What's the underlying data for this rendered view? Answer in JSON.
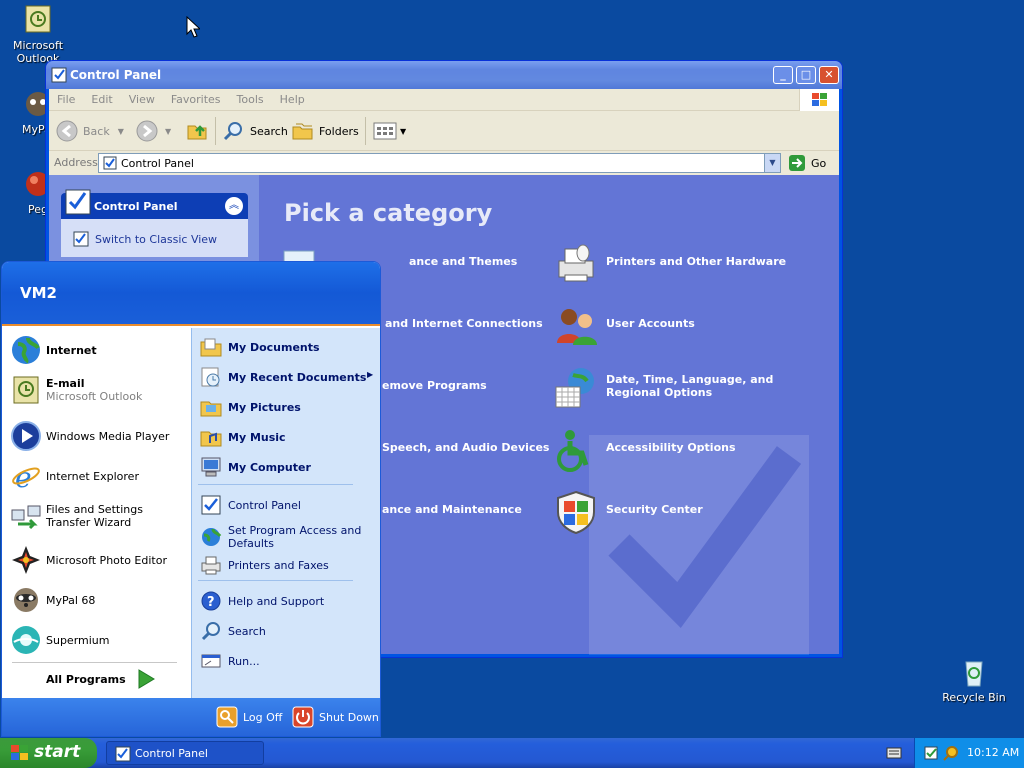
{
  "desktop": {
    "icons": [
      {
        "label": "Microsoft Outlook"
      },
      {
        "label": "MyPal"
      },
      {
        "label": "Peg"
      }
    ],
    "recycle_bin": "Recycle Bin"
  },
  "window": {
    "title": "Control Panel",
    "menu": [
      "File",
      "Edit",
      "View",
      "Favorites",
      "Tools",
      "Help"
    ],
    "toolbar": {
      "back": "Back",
      "search": "Search",
      "folders": "Folders"
    },
    "address_label": "Address",
    "address_value": "Control Panel",
    "go_label": "Go",
    "sidebar_title": "Control Panel",
    "sidebar_link": "Switch to Classic View",
    "heading": "Pick a category",
    "categories_left": [
      "ance and Themes",
      "and Internet Connections",
      "emove Programs",
      "Speech, and Audio Devices",
      "ance and Maintenance"
    ],
    "categories_right": [
      "Printers and Other Hardware",
      "User Accounts",
      "Date, Time, Language, and Regional Options",
      "Accessibility Options",
      "Security Center"
    ]
  },
  "start_menu": {
    "user": "VM2",
    "left_items": [
      {
        "label": "Internet",
        "sub": ""
      },
      {
        "label": "E-mail",
        "sub": "Microsoft Outlook"
      },
      {
        "label": "Windows Media Player",
        "sub": ""
      },
      {
        "label": "Internet Explorer",
        "sub": ""
      },
      {
        "label": "Files and Settings Transfer Wizard",
        "sub": ""
      },
      {
        "label": "Microsoft Photo Editor",
        "sub": ""
      },
      {
        "label": "MyPal 68",
        "sub": ""
      },
      {
        "label": "Supermium",
        "sub": ""
      }
    ],
    "all_programs": "All Programs",
    "right_items": [
      "My Documents",
      "My Recent Documents",
      "My Pictures",
      "My Music",
      "My Computer",
      "Control Panel",
      "Set Program Access and Defaults",
      "Printers and Faxes",
      "Help and Support",
      "Search",
      "Run..."
    ],
    "log_off": "Log Off",
    "shut_down": "Shut Down"
  },
  "taskbar": {
    "start": "start",
    "task": "Control Panel",
    "clock": "10:12 AM"
  },
  "colors": {
    "desktop": "#0a4aa0",
    "content": "#6375d6",
    "start_button": "#389c38",
    "taskbar": "#245edb"
  }
}
